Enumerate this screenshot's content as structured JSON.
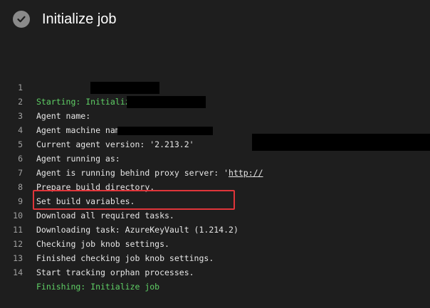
{
  "header": {
    "title": "Initialize job",
    "status_icon": "check-icon",
    "status_color": "#8a8a8a"
  },
  "log": {
    "lines": [
      {
        "number": "1",
        "text": "Starting: Initialize job",
        "style": "green"
      },
      {
        "number": "2",
        "text": "Agent name: ",
        "style": "normal",
        "redacted": true
      },
      {
        "number": "3",
        "text": "Agent machine name: ",
        "style": "normal",
        "redacted": true
      },
      {
        "number": "4",
        "text": "Current agent version: '2.213.2'",
        "style": "normal"
      },
      {
        "number": "5",
        "text": "Agent running as: ",
        "style": "normal",
        "redacted": true
      },
      {
        "number": "6",
        "text": "Agent is running behind proxy server: '",
        "link_text": "http://",
        "style": "normal",
        "redacted": true
      },
      {
        "number": "7",
        "text": "Prepare build directory.",
        "style": "normal"
      },
      {
        "number": "8",
        "text": "Set build variables.",
        "style": "normal"
      },
      {
        "number": "9",
        "text": "Download all required tasks.",
        "style": "normal"
      },
      {
        "number": "10",
        "text": "Downloading task: AzureKeyVault (1.214.2)",
        "style": "normal",
        "highlighted": true
      },
      {
        "number": "11",
        "text": "Checking job knob settings.",
        "style": "normal"
      },
      {
        "number": "12",
        "text": "Finished checking job knob settings.",
        "style": "normal"
      },
      {
        "number": "13",
        "text": "Start tracking orphan processes.",
        "style": "normal"
      },
      {
        "number": "14",
        "text": "Finishing: Initialize job",
        "style": "green"
      }
    ]
  },
  "colors": {
    "background": "#1e1e1e",
    "text": "#e6e6e6",
    "success_green": "#5fcf65",
    "line_number": "#a0a0a0",
    "highlight_border": "#e0353a"
  }
}
